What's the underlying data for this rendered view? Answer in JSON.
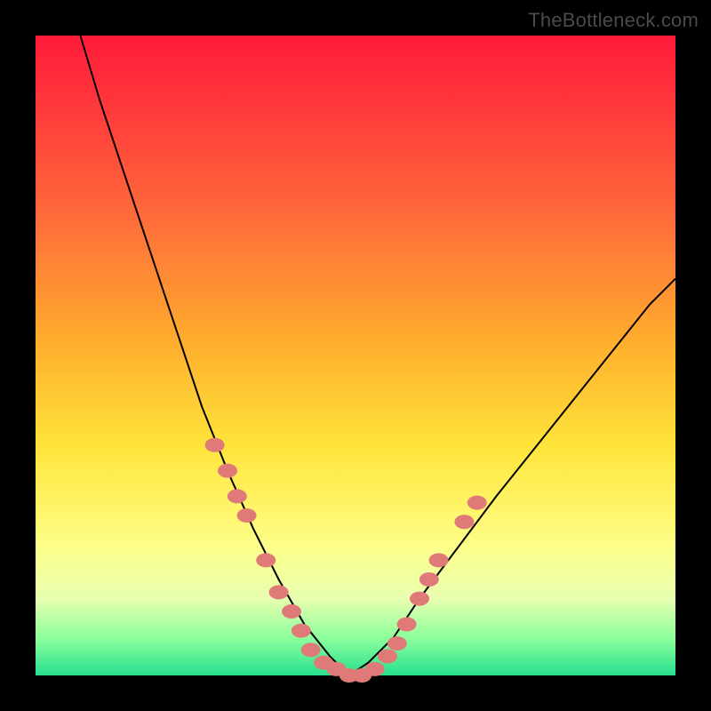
{
  "watermark": "TheBottleneck.com",
  "colors": {
    "frame": "#000000",
    "gradient_top": "#ff1a3a",
    "gradient_bottom": "#28e08f",
    "curve": "#000000",
    "dots": "#e07a78"
  },
  "chart_data": {
    "type": "line",
    "title": "",
    "xlabel": "",
    "ylabel": "",
    "xlim": [
      0,
      100
    ],
    "ylim": [
      0,
      100
    ],
    "comment": "V-shaped bottleneck curve. x is horizontal position (0=left, 100=right). y is vertical (0=bottom/green, 100=top/red). No numeric axis labels are visible; values are estimated from pixel positions.",
    "series": [
      {
        "name": "curve",
        "x": [
          7,
          10,
          14,
          18,
          22,
          26,
          30,
          34,
          38,
          42,
          46,
          49,
          52,
          56,
          60,
          66,
          72,
          80,
          88,
          96,
          100
        ],
        "values": [
          100,
          90,
          78,
          66,
          54,
          42,
          32,
          23,
          15,
          8,
          3,
          0,
          2,
          6,
          12,
          20,
          28,
          38,
          48,
          58,
          62
        ]
      }
    ],
    "dots": [
      {
        "x": 28,
        "y": 36
      },
      {
        "x": 30,
        "y": 32
      },
      {
        "x": 31.5,
        "y": 28
      },
      {
        "x": 33,
        "y": 25
      },
      {
        "x": 36,
        "y": 18
      },
      {
        "x": 38,
        "y": 13
      },
      {
        "x": 40,
        "y": 10
      },
      {
        "x": 41.5,
        "y": 7
      },
      {
        "x": 43,
        "y": 4
      },
      {
        "x": 45,
        "y": 2
      },
      {
        "x": 47,
        "y": 1
      },
      {
        "x": 49,
        "y": 0
      },
      {
        "x": 51,
        "y": 0
      },
      {
        "x": 53,
        "y": 1
      },
      {
        "x": 55,
        "y": 3
      },
      {
        "x": 56.5,
        "y": 5
      },
      {
        "x": 58,
        "y": 8
      },
      {
        "x": 60,
        "y": 12
      },
      {
        "x": 61.5,
        "y": 15
      },
      {
        "x": 63,
        "y": 18
      },
      {
        "x": 67,
        "y": 24
      },
      {
        "x": 69,
        "y": 27
      }
    ]
  }
}
